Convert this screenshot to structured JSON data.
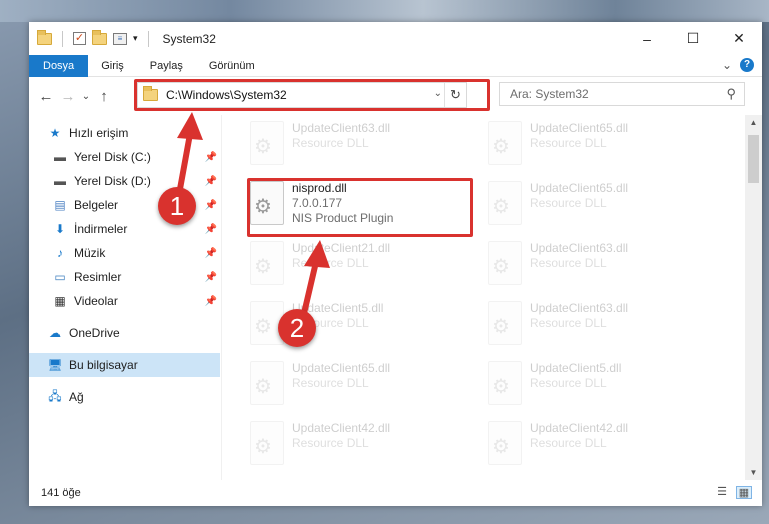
{
  "window": {
    "title": "System32",
    "minimize": "–",
    "maximize": "☐",
    "close": "✕"
  },
  "ribbon": {
    "tabs": [
      {
        "label": "Dosya"
      },
      {
        "label": "Giriş"
      },
      {
        "label": "Paylaş"
      },
      {
        "label": "Görünüm"
      }
    ],
    "expand": "⌄",
    "help": "?"
  },
  "navigation": {
    "back": "←",
    "forward": "→",
    "recent": "⌄",
    "up": "↑",
    "address": "C:\\Windows\\System32",
    "address_dropdown": "⌄",
    "refresh": "↻",
    "search_placeholder": "Ara: System32",
    "search_icon": "⚲"
  },
  "sidebar": {
    "quick_access": "Hızlı erişim",
    "items": [
      {
        "label": "Yerel Disk (C:)",
        "icon": "drive-icon"
      },
      {
        "label": "Yerel Disk (D:)",
        "icon": "drive-icon"
      },
      {
        "label": "Belgeler",
        "icon": "documents-icon"
      },
      {
        "label": "İndirmeler",
        "icon": "downloads-icon"
      },
      {
        "label": "Müzik",
        "icon": "music-icon"
      },
      {
        "label": "Resimler",
        "icon": "pictures-icon"
      },
      {
        "label": "Videolar",
        "icon": "videos-icon"
      }
    ],
    "onedrive": "OneDrive",
    "this_pc": "Bu bilgisayar",
    "network": "Ağ"
  },
  "files": {
    "left": [
      {
        "name": "UpdateClient63.dll",
        "desc": "Resource DLL"
      },
      {
        "name": "nisprod.dll",
        "version": "7.0.0.177",
        "desc": "NIS Product Plugin"
      },
      {
        "name": "UpdateClient21.dll",
        "desc": "Resource DLL"
      },
      {
        "name": "UpdateClient5.dll",
        "desc": "Resource DLL"
      },
      {
        "name": "UpdateClient65.dll",
        "desc": "Resource DLL"
      },
      {
        "name": "UpdateClient42.dll",
        "desc": "Resource DLL"
      }
    ],
    "right": [
      {
        "name": "UpdateClient65.dll",
        "desc": "Resource DLL"
      },
      {
        "name": "UpdateClient65.dll",
        "desc": "Resource DLL"
      },
      {
        "name": "UpdateClient63.dll",
        "desc": "Resource DLL"
      },
      {
        "name": "UpdateClient63.dll",
        "desc": "Resource DLL"
      },
      {
        "name": "UpdateClient5.dll",
        "desc": "Resource DLL"
      },
      {
        "name": "UpdateClient42.dll",
        "desc": "Resource DLL"
      }
    ]
  },
  "status": {
    "count": "141 öğe"
  },
  "markers": {
    "one": "1",
    "two": "2"
  },
  "colors": {
    "accent": "#1979ca",
    "highlight": "#d9322e",
    "selected": "#cce4f7"
  }
}
